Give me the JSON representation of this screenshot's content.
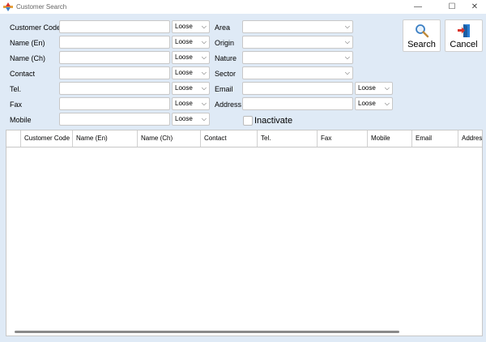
{
  "window": {
    "title": "Customer Search",
    "minimize": "—",
    "maximize": "☐",
    "close": "✕"
  },
  "form": {
    "left": [
      {
        "label": "Customer Code",
        "value": "",
        "mode": "Loose"
      },
      {
        "label": "Name (En)",
        "value": "",
        "mode": "Loose"
      },
      {
        "label": "Name (Ch)",
        "value": "",
        "mode": "Loose"
      },
      {
        "label": "Contact",
        "value": "",
        "mode": "Loose"
      },
      {
        "label": "Tel.",
        "value": "",
        "mode": "Loose"
      },
      {
        "label": "Fax",
        "value": "",
        "mode": "Loose"
      },
      {
        "label": "Mobile",
        "value": "",
        "mode": "Loose"
      }
    ],
    "right_dropdowns": [
      {
        "label": "Area",
        "value": ""
      },
      {
        "label": "Origin",
        "value": ""
      },
      {
        "label": "Nature",
        "value": ""
      },
      {
        "label": "Sector",
        "value": ""
      }
    ],
    "right_text": [
      {
        "label": "Email",
        "value": "",
        "mode": "Loose"
      },
      {
        "label": "Address",
        "value": "",
        "mode": "Loose"
      }
    ],
    "inactivate_label": "Inactivate"
  },
  "buttons": {
    "search": "Search",
    "cancel": "Cancel"
  },
  "grid": {
    "columns": [
      "",
      "Customer Code",
      "Name (En)",
      "Name (Ch)",
      "Contact",
      "Tel.",
      "Fax",
      "Mobile",
      "Email",
      "Address"
    ]
  },
  "colors": {
    "background": "#dfeaf6",
    "search_icon": "#3b7fc4",
    "cancel_icon_door": "#2a7fd4",
    "cancel_icon_arrow": "#d9342b"
  }
}
